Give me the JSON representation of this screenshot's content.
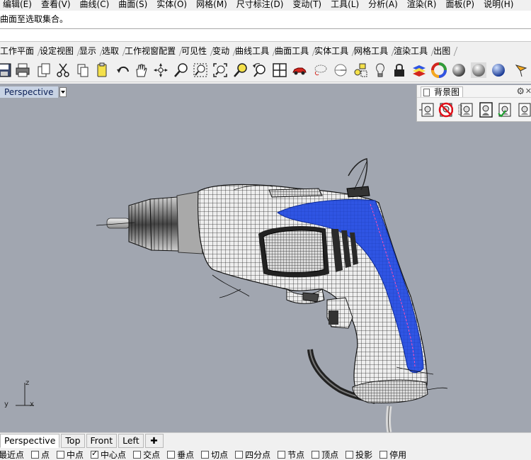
{
  "menu": [
    "编辑(E)",
    "查看(V)",
    "曲线(C)",
    "曲面(S)",
    "实体(O)",
    "网格(M)",
    "尺寸标注(D)",
    "变动(T)",
    "工具(L)",
    "分析(A)",
    "渲染(R)",
    "面板(P)",
    "说明(H)"
  ],
  "command": {
    "history": "曲面至选取集合。",
    "prompt": ""
  },
  "toolbar_tabs": [
    "工作平面",
    "设定视图",
    "显示",
    "选取",
    "工作视窗配置",
    "可见性",
    "变动",
    "曲线工具",
    "曲面工具",
    "实体工具",
    "网格工具",
    "渲染工具",
    "出图"
  ],
  "toolbar_icons": [
    "save-icon",
    "print-icon",
    "copy-icon",
    "cut-icon",
    "paste-icon",
    "clipboard-icon",
    "undo-icon",
    "pan-hand-icon",
    "rotate-view-icon",
    "zoom-icon",
    "zoom-window-icon",
    "zoom-extents-icon",
    "zoom-selected-icon",
    "undo-view-icon",
    "viewport-layout-icon",
    "car-icon",
    "lasso-icon",
    "cplane-icon",
    "objects-icon",
    "light-icon",
    "lock-icon",
    "layers-icon",
    "color-wheel-icon",
    "material-sphere-icon",
    "rendered-sphere-icon",
    "render-icon",
    "options-icon"
  ],
  "viewport": {
    "title": "Perspective",
    "axis_z": "z",
    "axis_y": "y",
    "axis_x": "x"
  },
  "background_panel": {
    "title": "背景图",
    "icons": [
      "place-background-icon",
      "remove-background-icon",
      "move-background-icon",
      "scale-background-icon",
      "align-background-icon",
      "grayscale-background-icon"
    ]
  },
  "viewport_tabs": [
    "Perspective",
    "Top",
    "Front",
    "Left"
  ],
  "osnaps": [
    {
      "label": "最近点",
      "checked": false
    },
    {
      "label": "点",
      "checked": false
    },
    {
      "label": "中点",
      "checked": false
    },
    {
      "label": "中心点",
      "checked": true
    },
    {
      "label": "交点",
      "checked": false
    },
    {
      "label": "垂点",
      "checked": false
    },
    {
      "label": "切点",
      "checked": false
    },
    {
      "label": "四分点",
      "checked": false
    },
    {
      "label": "节点",
      "checked": false
    },
    {
      "label": "顶点",
      "checked": false
    },
    {
      "label": "投影",
      "checked": false
    },
    {
      "label": "停用",
      "checked": false
    }
  ],
  "colors": {
    "viewport_bg": "#a1a6b0",
    "handle_blue": "#2f55e3",
    "title_highlight": "#c8d3e4"
  }
}
